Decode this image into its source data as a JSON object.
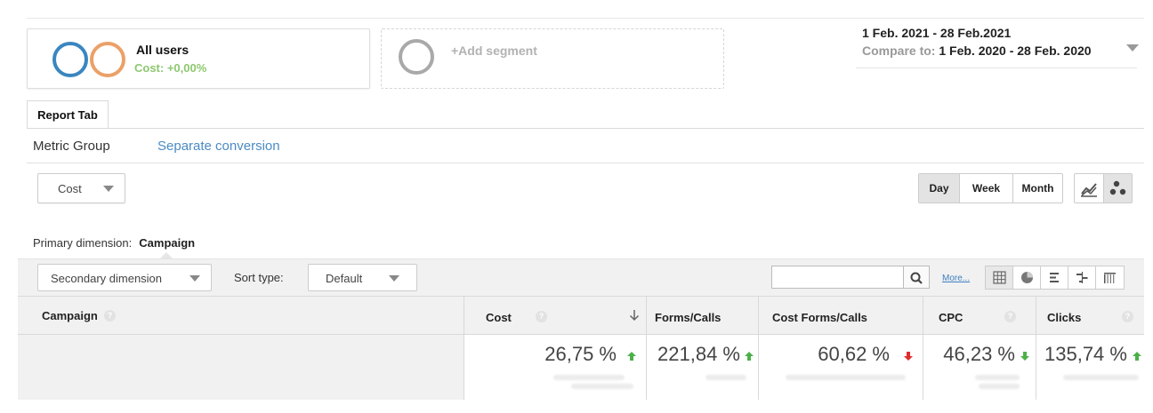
{
  "segments": {
    "primary": {
      "title": "All users",
      "subtitle": "Cost: +0,00%"
    },
    "add": {
      "label": "+Add segment"
    }
  },
  "date": {
    "range": "1 Feb. 2021 - 28 Feb.2021",
    "compare_label": "Compare to:",
    "compare_range": "1 Feb. 2020 - 28 Feb. 2020"
  },
  "tabs": {
    "report": "Report Tab"
  },
  "metric_groups": {
    "group": "Metric Group",
    "separate": "Separate conversion"
  },
  "metric_select": {
    "value": "Cost"
  },
  "interval": {
    "day": "Day",
    "week": "Week",
    "month": "Month",
    "selected": "Day"
  },
  "primary_dimension": {
    "label": "Primary dimension:",
    "value": "Campaign"
  },
  "toolbar": {
    "secondary": "Secondary dimension",
    "sort_label": "Sort type:",
    "sort_value": "Default",
    "more": "More..."
  },
  "table": {
    "columns": [
      {
        "key": "campaign",
        "label": "Campaign"
      },
      {
        "key": "cost",
        "label": "Cost"
      },
      {
        "key": "forms_calls",
        "label": "Forms/Calls"
      },
      {
        "key": "cost_forms_calls",
        "label": "Cost Forms/Calls"
      },
      {
        "key": "cpc",
        "label": "CPC"
      },
      {
        "key": "clicks",
        "label": "Clicks"
      }
    ],
    "summary": {
      "cost": "26,75 %",
      "forms_calls": "221,84 %",
      "cost_forms_calls": "60,62 %",
      "cpc": "46,23 %",
      "clicks": "135,74 %"
    },
    "trend": {
      "cost": "up",
      "forms_calls": "up",
      "cost_forms_calls": "down",
      "cpc": "down",
      "clicks": "up"
    }
  },
  "colors": {
    "up": "#4cb04a",
    "down": "#e02d2d",
    "link": "#4a8bc4",
    "segment_sub": "#8dc86f"
  }
}
